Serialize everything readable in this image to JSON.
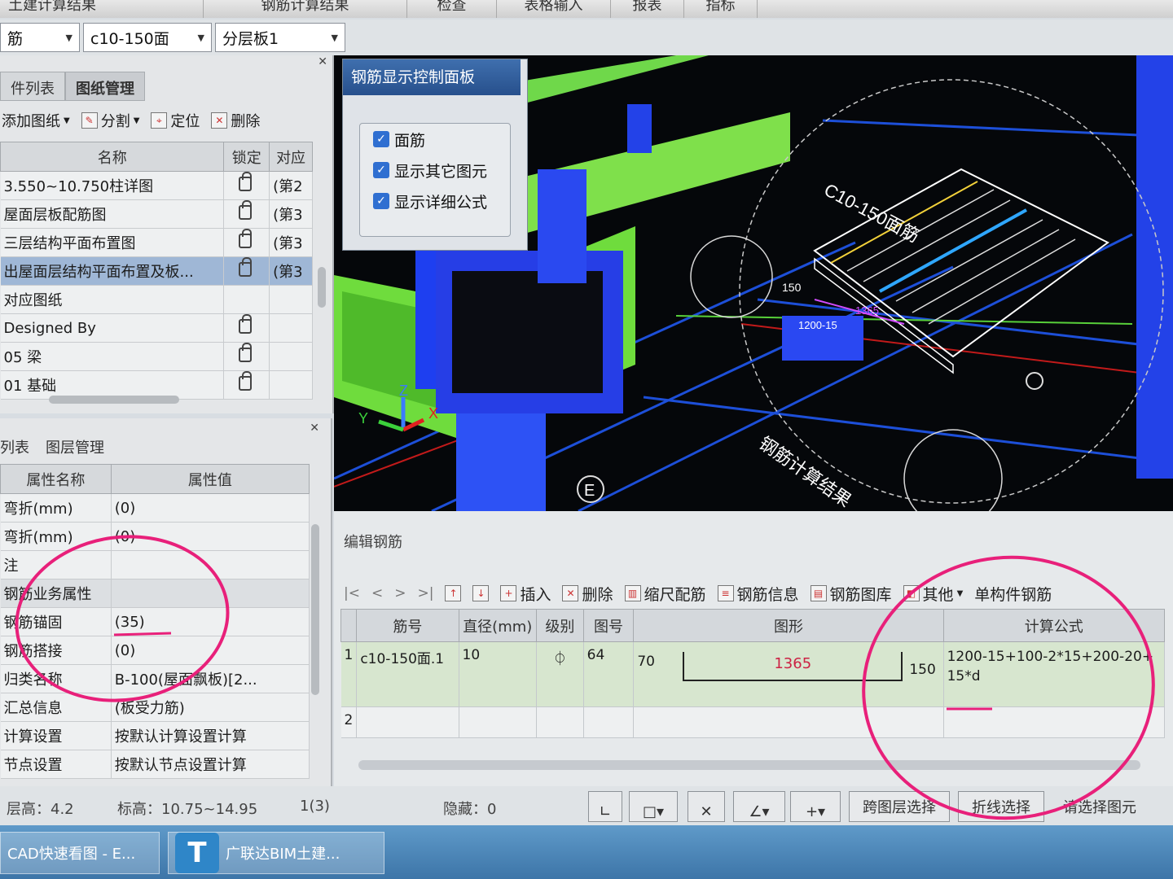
{
  "menu": [
    "土建计算结果",
    "钢筋计算结果",
    "检查",
    "表格输入",
    "报表",
    "指标"
  ],
  "selectors": [
    {
      "value": "筋"
    },
    {
      "value": "c10-150面"
    },
    {
      "value": "分层板1"
    }
  ],
  "drawing_panel": {
    "tabs": [
      "件列表",
      "图纸管理"
    ],
    "tools": [
      "添加图纸",
      "分割",
      "定位",
      "删除"
    ],
    "columns": [
      "名称",
      "锁定",
      "对应"
    ],
    "rows": [
      {
        "name": "3.550~10.750柱详图",
        "link": "(第2"
      },
      {
        "name": "屋面层板配筋图",
        "link": "(第3"
      },
      {
        "name": "三层结构平面布置图",
        "link": "(第3"
      },
      {
        "name": "出屋面层结构平面布置及板...",
        "link": "(第3"
      },
      {
        "name": "对应图纸",
        "link": ""
      },
      {
        "name": "Designed By",
        "link": ""
      },
      {
        "name": "05 梁",
        "link": ""
      },
      {
        "name": "01 基础",
        "link": ""
      }
    ]
  },
  "property_panel": {
    "tabs": [
      "列表",
      "图层管理"
    ],
    "columns": [
      "属性名称",
      "属性值"
    ],
    "rows": [
      {
        "name": "弯折(mm)",
        "value": "(0)"
      },
      {
        "name": "弯折(mm)",
        "value": "(0)"
      },
      {
        "name": "注",
        "value": ""
      },
      {
        "name": "钢筋业务属性",
        "value": ""
      },
      {
        "name": "钢筋锚固",
        "value": "(35)"
      },
      {
        "name": "钢筋搭接",
        "value": "(0)"
      },
      {
        "name": "归类名称",
        "value": "B-100(屋面飘板)[2..."
      },
      {
        "name": "汇总信息",
        "value": "(板受力筋)"
      },
      {
        "name": "计算设置",
        "value": "按默认计算设置计算"
      },
      {
        "name": "节点设置",
        "value": "按默认节点设置计算"
      }
    ]
  },
  "control_panel": {
    "title": "钢筋显示控制面板",
    "options": [
      "面筋",
      "显示其它图元",
      "显示详细公式"
    ]
  },
  "viewport": {
    "axis_x": "X",
    "axis_y": "Y",
    "axis_z": "Z",
    "grid_label": "E",
    "label_rebar": "C10-150面筋",
    "label_150": "150",
    "label_1200": "1200-15",
    "label_1365": "1365",
    "label_cn": "钢筋计算结果"
  },
  "edit_rebar": {
    "title": "编辑钢筋",
    "nav": [
      "|<",
      "<",
      ">",
      ">|"
    ],
    "tools": [
      "插入",
      "删除",
      "缩尺配筋",
      "钢筋信息",
      "钢筋图库",
      "其他",
      "单构件钢筋"
    ],
    "columns": [
      "筋号",
      "直径(mm)",
      "级别",
      "图号",
      "图形",
      "计算公式"
    ],
    "rows": [
      {
        "index": "1",
        "name": "c10-150面.1",
        "diameter": "10",
        "grade": "⏀",
        "shape_no": "64",
        "left": "70",
        "length": "1365",
        "right": "150",
        "formula": "1200-15+100-2*15+200-20+15*d"
      },
      {
        "index": "2",
        "name": "",
        "diameter": "",
        "grade": "",
        "shape_no": "",
        "left": "",
        "length": "",
        "right": "",
        "formula": ""
      }
    ]
  },
  "status": {
    "floor_height": "层高：4.2",
    "elevation": "标高：10.75~14.95",
    "count": "1(3)",
    "hidden": "隐藏：0",
    "buttons": [
      "跨图层选择",
      "折线选择",
      "请选择图元"
    ]
  },
  "taskbar": {
    "items": [
      "CAD快速看图 - E...",
      "广联达BIM土建..."
    ],
    "logo": "T"
  },
  "colors": {
    "annotation": "#e8207a",
    "selected_row": "#9fb7d6",
    "panel_title": "#2f5d9e"
  }
}
